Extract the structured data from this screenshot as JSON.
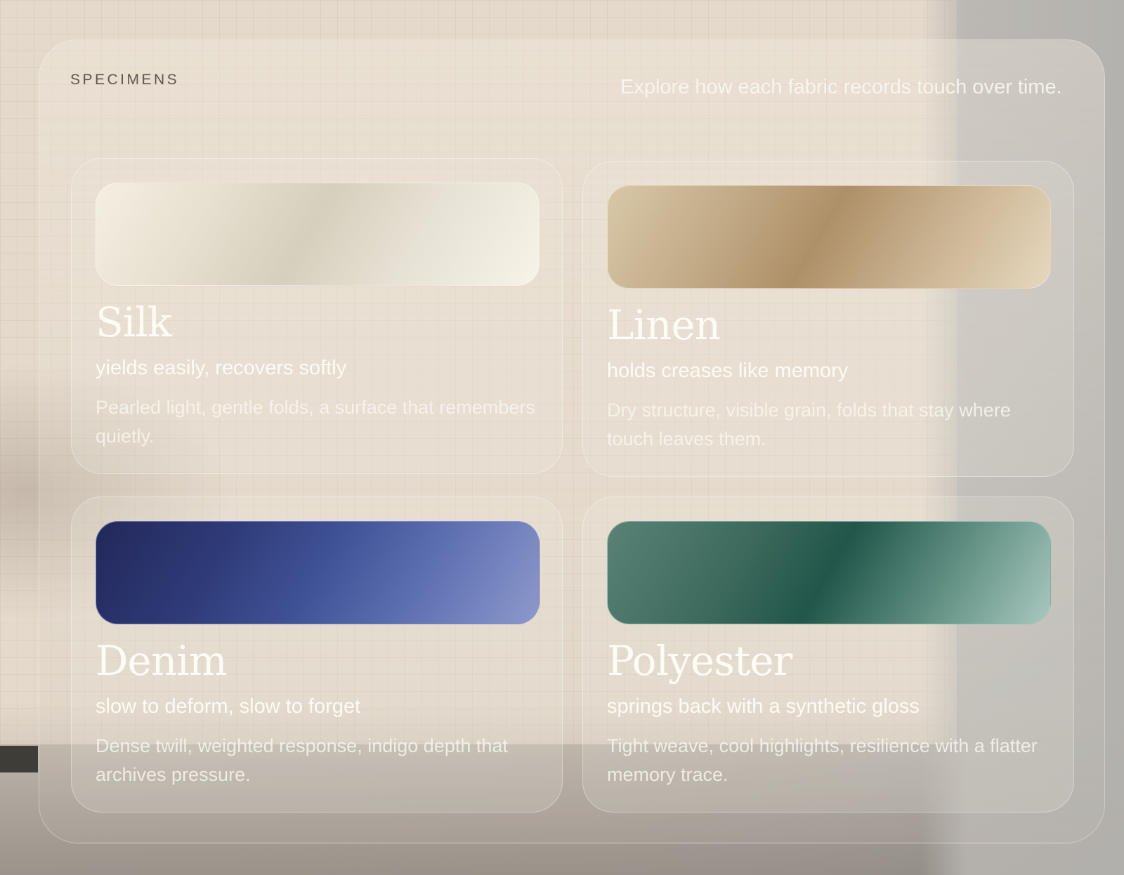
{
  "header": {
    "kicker": "SPECIMENS",
    "intro": "Explore how each fabric records touch over time."
  },
  "fabrics": [
    {
      "name": "Silk",
      "tagline": "yields easily, recovers softly",
      "description": "Pearled light, gentle folds, a surface that remembers quietly.",
      "swatch_colors": [
        "#f5efe3",
        "#d7cfbd",
        "#f7f3e8"
      ]
    },
    {
      "name": "Linen",
      "tagline": "holds creases like memory",
      "description": "Dry structure, visible grain, folds that stay where touch leaves them.",
      "swatch_colors": [
        "#d8c8a8",
        "#ae9068",
        "#e6d8be"
      ]
    },
    {
      "name": "Denim",
      "tagline": "slow to deform, slow to forget",
      "description": "Dense twill, weighted response, indigo depth that archives pressure.",
      "swatch_colors": [
        "#22285a",
        "#3f5296",
        "#8e99cc"
      ]
    },
    {
      "name": "Polyester",
      "tagline": "springs back with a synthetic gloss",
      "description": "Tight weave, cool highlights, resilience with a flatter memory trace.",
      "swatch_colors": [
        "#5a8276",
        "#22564a",
        "#a9c8bf"
      ]
    }
  ]
}
